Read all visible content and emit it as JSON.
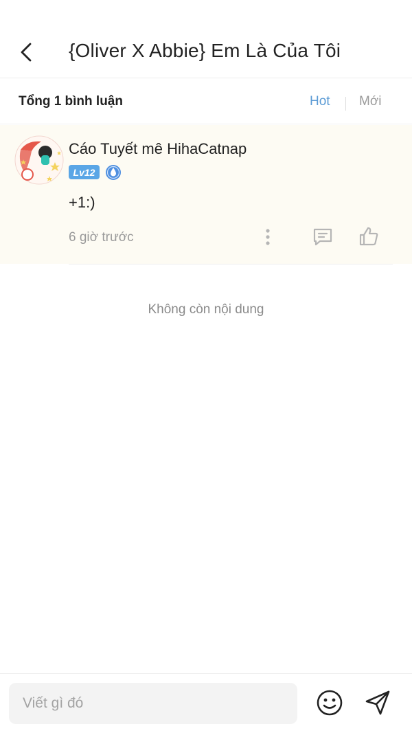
{
  "header": {
    "title": "{Oliver X Abbie} Em Là Của Tôi",
    "back_icon": "chevron-left-icon"
  },
  "comments_bar": {
    "total_label": "Tổng 1 bình luận",
    "sort_options": [
      "Hot",
      "Mới"
    ],
    "selected_sort": "Hot",
    "accent_color": "#5b9bd5"
  },
  "comment": {
    "author": "Cáo Tuyết mê HihaCatnap",
    "level": "Lv12",
    "badge_icon": "water-drop-badge-icon",
    "text": "+1:)",
    "time": "6 giờ trước",
    "actions": [
      "more-vertical-icon",
      "reply-icon",
      "like-icon"
    ],
    "background_color": "#fdfbf3"
  },
  "end_message": "Không còn nội dung",
  "footer": {
    "input_placeholder": "Viết gì đó",
    "emoji_icon": "smiley-icon",
    "send_icon": "send-icon"
  }
}
